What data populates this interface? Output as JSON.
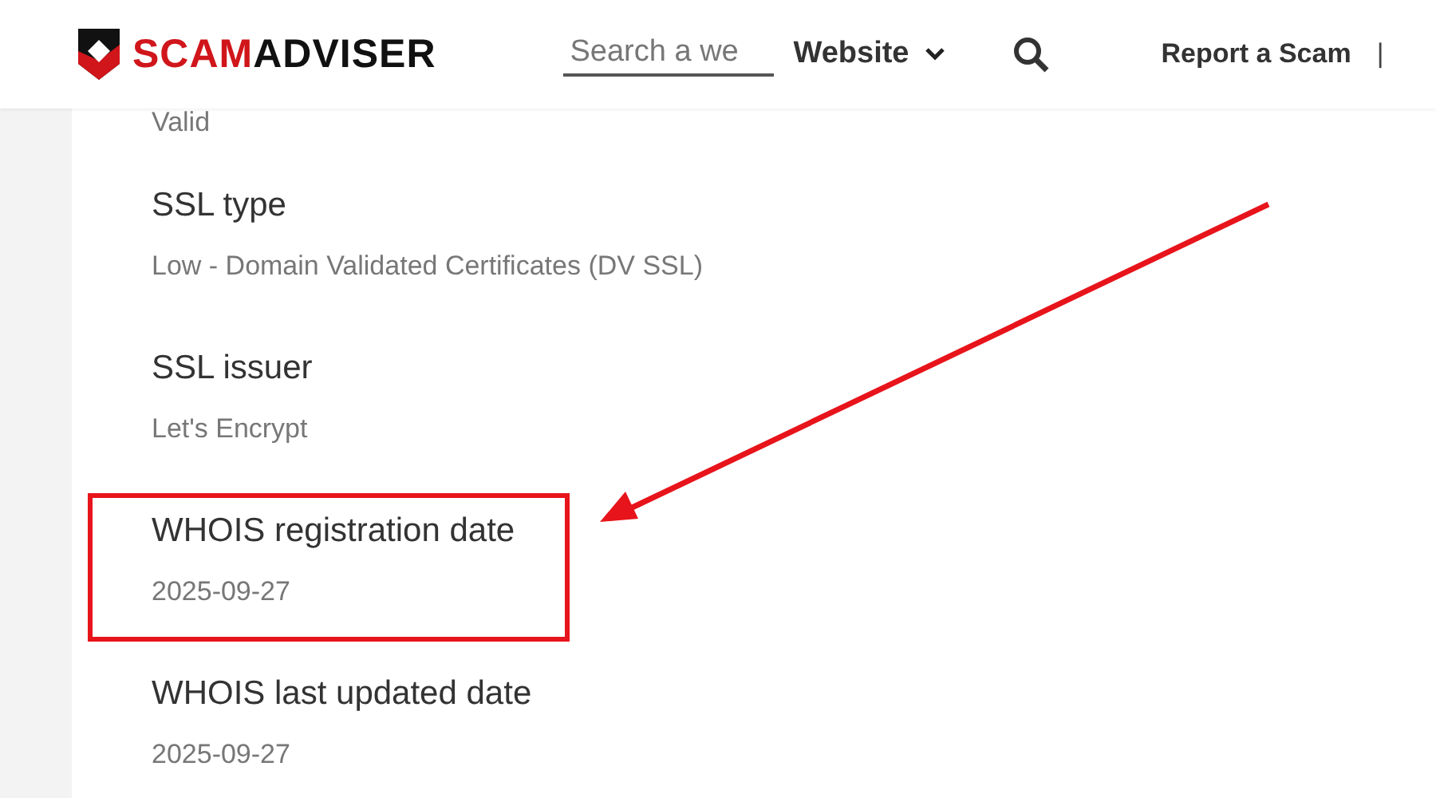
{
  "header": {
    "search": {
      "placeholder": "Search a we"
    },
    "search_type": "Website",
    "report_link": "Report a Scam",
    "separator": "|"
  },
  "details": [
    {
      "value": "Valid",
      "highlighted": false
    },
    {
      "label": "SSL type",
      "value": "Low - Domain Validated Certificates (DV SSL)",
      "highlighted": false
    },
    {
      "label": "SSL issuer",
      "value": "Let's Encrypt",
      "highlighted": false
    },
    {
      "label": "WHOIS registration date",
      "value": "2025-09-27",
      "highlighted": true
    },
    {
      "label": "WHOIS last updated date",
      "value": "2025-09-27",
      "highlighted": false
    }
  ],
  "logo": {
    "part_1": "SCAM",
    "part_2": "ADVISER"
  }
}
